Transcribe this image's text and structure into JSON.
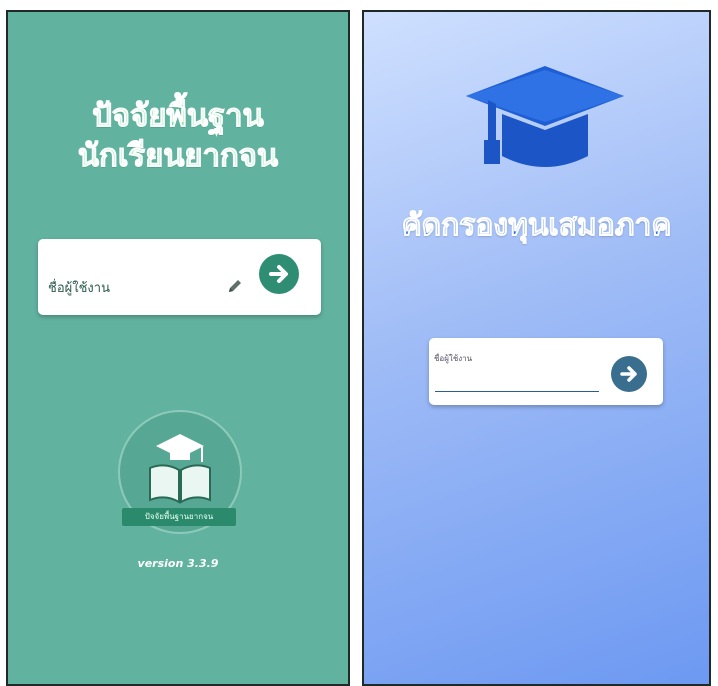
{
  "left_screen": {
    "title_line1": "ปัจจัยพื้นฐาน",
    "title_line2": "นักเรียนยากจน",
    "username_label": "ชื่อผู้ใช้งาน",
    "edit_icon": "pencil-icon",
    "submit_icon": "arrow-right-icon",
    "logo_caption": "ปัจจัยพื้นฐานยากจน",
    "version": "version 3.3.9",
    "background_color": "#62b2a0",
    "button_color": "#2f8d74"
  },
  "right_screen": {
    "title": "คัดกรองทุนเสมอภาค",
    "logo_icon": "graduation-cap-icon",
    "username_label": "ชื่อผู้ใช้งาน",
    "submit_icon": "arrow-right-icon",
    "title_color": "#2a6ff0",
    "button_color": "#3a6e8e"
  }
}
